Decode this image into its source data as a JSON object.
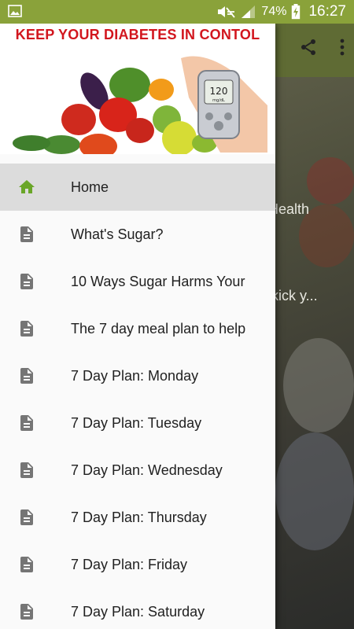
{
  "status_bar": {
    "battery": "74%",
    "time": "16:27"
  },
  "background_screen": {
    "visible_fragments": [
      "r Health",
      "o kick y..."
    ]
  },
  "drawer": {
    "header_title": "KEEP YOUR DIABETES IN CONTOL",
    "glucose_meter_reading": "120",
    "glucose_meter_unit": "mg/dL",
    "items": [
      {
        "label": "Home",
        "icon": "home-icon",
        "active": true
      },
      {
        "label": "What's Sugar?",
        "icon": "document-icon"
      },
      {
        "label": "10 Ways Sugar Harms Your",
        "icon": "document-icon"
      },
      {
        "label": "The 7 day meal plan to help",
        "icon": "document-icon"
      },
      {
        "label": "7 Day Plan: Monday",
        "icon": "document-icon"
      },
      {
        "label": "7 Day Plan: Tuesday",
        "icon": "document-icon"
      },
      {
        "label": "7 Day Plan: Wednesday",
        "icon": "document-icon"
      },
      {
        "label": "7 Day Plan: Thursday",
        "icon": "document-icon"
      },
      {
        "label": "7 Day Plan: Friday",
        "icon": "document-icon"
      },
      {
        "label": "7 Day Plan: Saturday",
        "icon": "document-icon"
      }
    ]
  },
  "colors": {
    "status_bar": "#8aa23a",
    "home_icon": "#6aa628",
    "doc_icon": "#757575",
    "header_title": "#d2161e",
    "active_item_bg": "#dcdcdc"
  }
}
